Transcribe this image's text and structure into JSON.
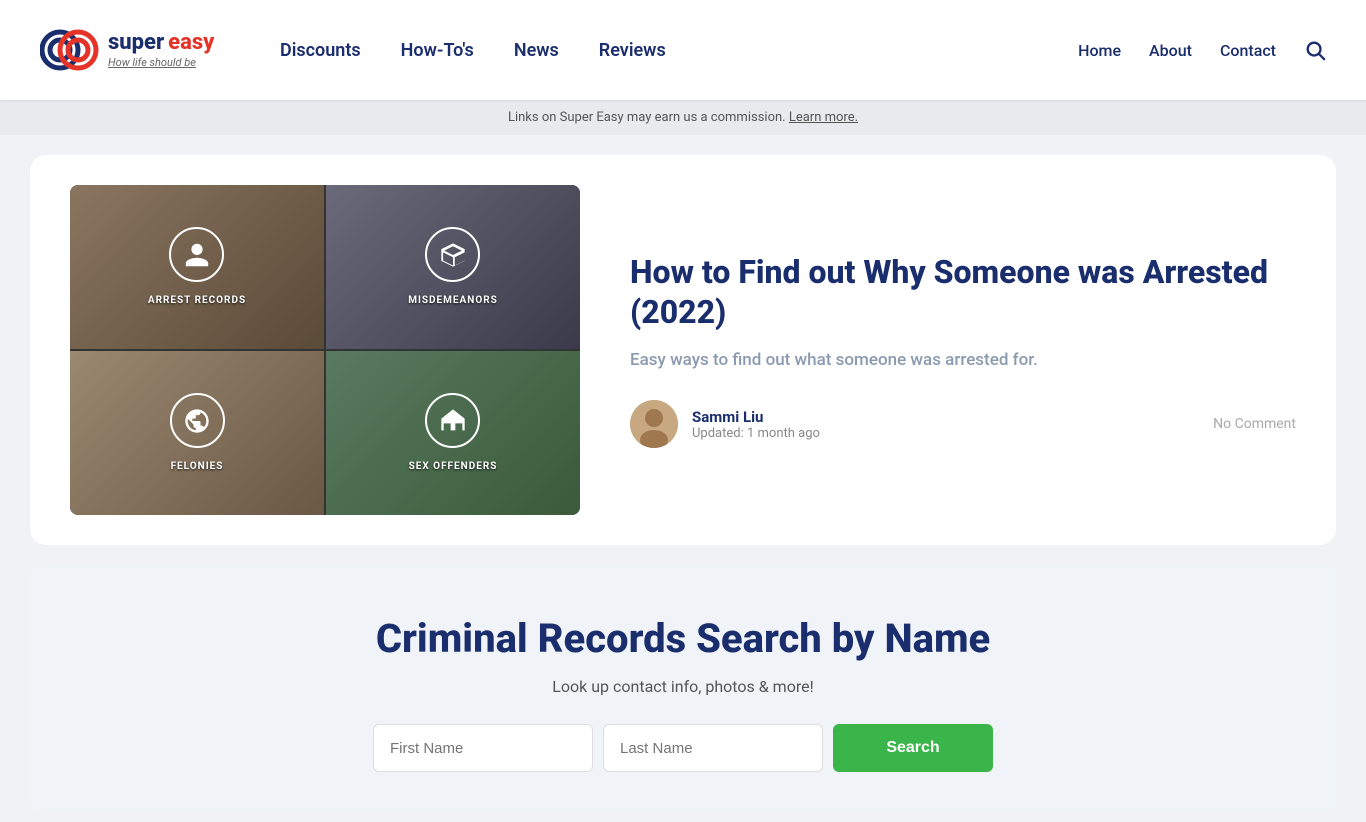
{
  "header": {
    "logo": {
      "super": "super",
      "easy": "easy",
      "tagline_prefix": "How life ",
      "tagline_emphasis": "should",
      "tagline_suffix": " be"
    },
    "nav": {
      "items": [
        {
          "label": "Discounts",
          "href": "#"
        },
        {
          "label": "How-To's",
          "href": "#"
        },
        {
          "label": "News",
          "href": "#"
        },
        {
          "label": "Reviews",
          "href": "#"
        }
      ]
    },
    "right_nav": {
      "items": [
        {
          "label": "Home",
          "href": "#"
        },
        {
          "label": "About",
          "href": "#"
        },
        {
          "label": "Contact",
          "href": "#"
        }
      ]
    }
  },
  "affiliate_banner": {
    "text": "Links on Super Easy may earn us a commission.",
    "link_text": "Learn more."
  },
  "article": {
    "title": "How to Find out Why Someone was Arrested (2022)",
    "subtitle": "Easy ways to find out what someone was arrested for.",
    "author": {
      "name": "Sammi Liu",
      "updated": "Updated: 1 month ago"
    },
    "no_comment": "No Comment",
    "image_cells": [
      {
        "label": "ARREST RECORDS",
        "icon": "person-icon"
      },
      {
        "label": "MISDEMEANORS",
        "icon": "gavel-icon"
      },
      {
        "label": "FELONIES",
        "icon": "database-icon"
      },
      {
        "label": "SEX OFFENDERS",
        "icon": "house-icon"
      }
    ]
  },
  "search_section": {
    "title": "Criminal Records Search by Name",
    "subtitle": "Look up contact info, photos & more!",
    "first_name_placeholder": "First Name",
    "last_name_placeholder": "Last Name",
    "button_label": "Search"
  },
  "icons": {
    "search": "🔍"
  }
}
